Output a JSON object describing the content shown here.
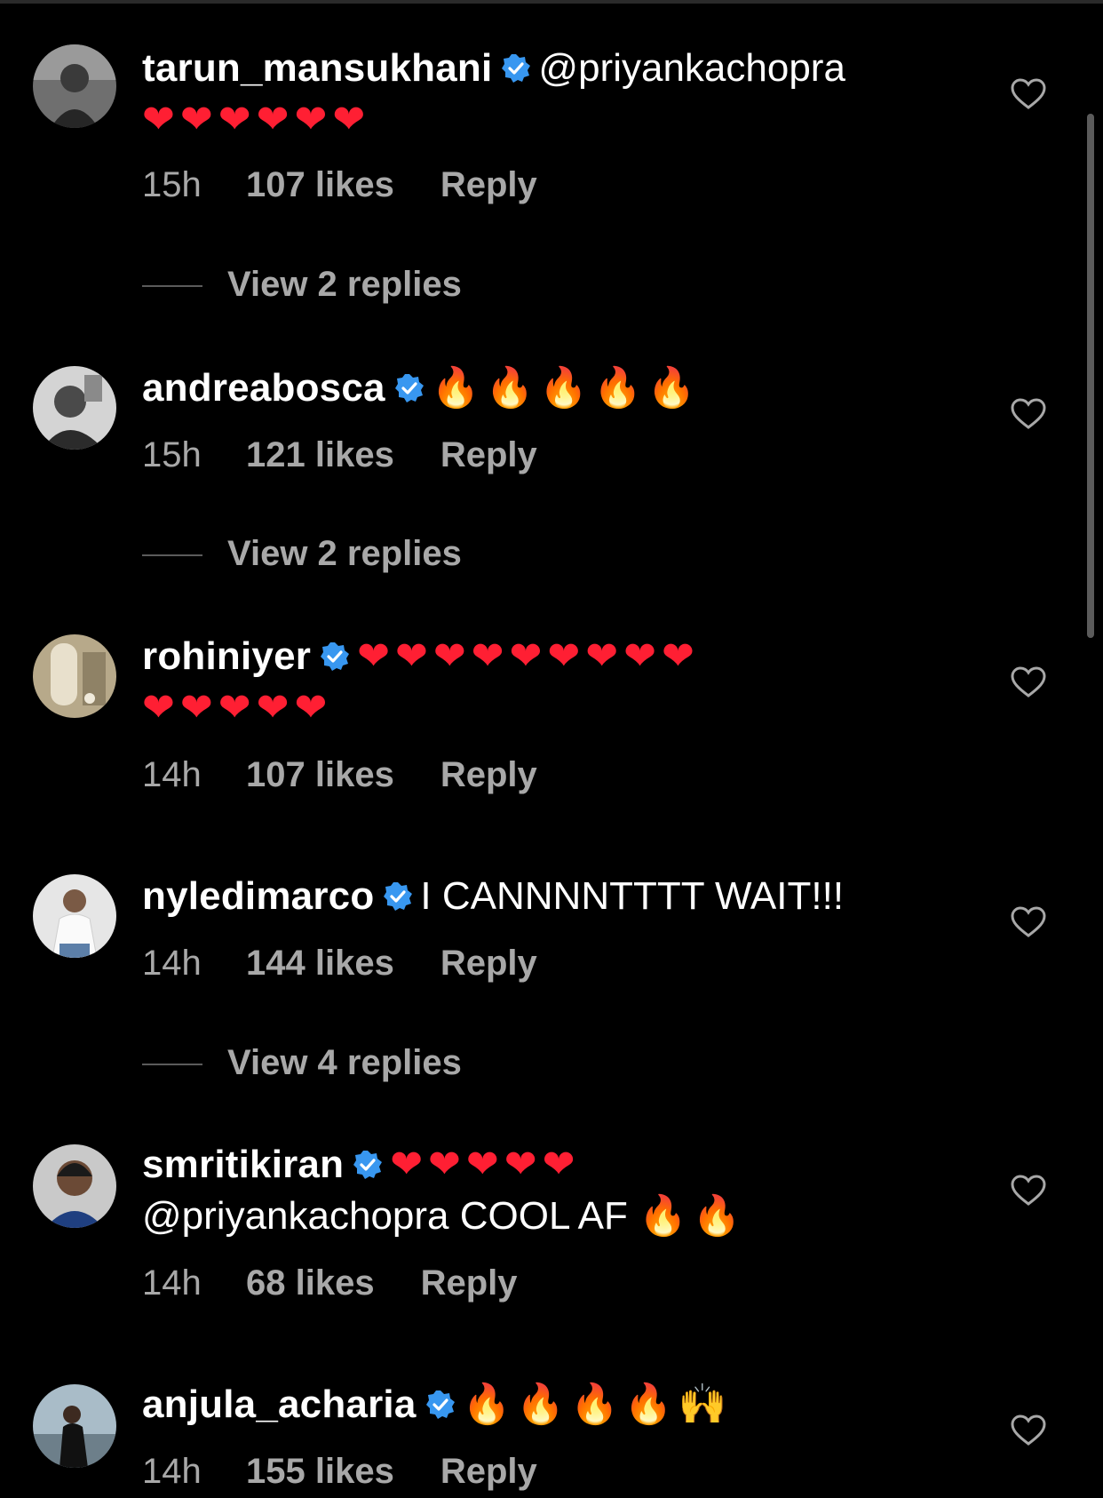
{
  "comments": [
    {
      "username": "tarun_mansukhani",
      "line1_text": "@priyankachopra",
      "line1_emoji": "",
      "line2_text": "",
      "line2_emoji": "❤❤❤❤❤❤",
      "time": "15h",
      "likes": "107 likes",
      "reply": "Reply",
      "view_replies": "View 2 replies"
    },
    {
      "username": "andreabosca",
      "line1_text": "",
      "line1_emoji": "🔥🔥🔥🔥🔥",
      "time": "15h",
      "likes": "121 likes",
      "reply": "Reply",
      "view_replies": "View 2 replies"
    },
    {
      "username": "rohiniyer",
      "line1_text": "",
      "line1_emoji": "❤❤❤❤❤❤❤❤❤",
      "line2_text": "",
      "line2_emoji": "❤❤❤❤❤",
      "time": "14h",
      "likes": "107 likes",
      "reply": "Reply"
    },
    {
      "username": "nyledimarco",
      "line1_text": "I CANNNNTTTT WAIT!!!",
      "line1_emoji": "",
      "time": "14h",
      "likes": "144 likes",
      "reply": "Reply",
      "view_replies": "View 4 replies"
    },
    {
      "username": "smritikiran",
      "line1_text": "",
      "line1_emoji": "❤❤❤❤❤",
      "line2_text": "@priyankachopra COOL AF",
      "line2_emoji": "🔥🔥",
      "time": "14h",
      "likes": "68 likes",
      "reply": "Reply"
    },
    {
      "username": "anjula_acharia",
      "line1_text": "",
      "line1_emoji": "🔥🔥🔥🔥🙌",
      "time": "14h",
      "likes": "155 likes",
      "reply": "Reply"
    }
  ],
  "icons": {
    "verified": "verified-badge-icon",
    "like": "heart-outline-icon"
  },
  "colors": {
    "background": "#000000",
    "text": "#ffffff",
    "secondary": "#a8a8a8",
    "verified": "#3897f0"
  }
}
